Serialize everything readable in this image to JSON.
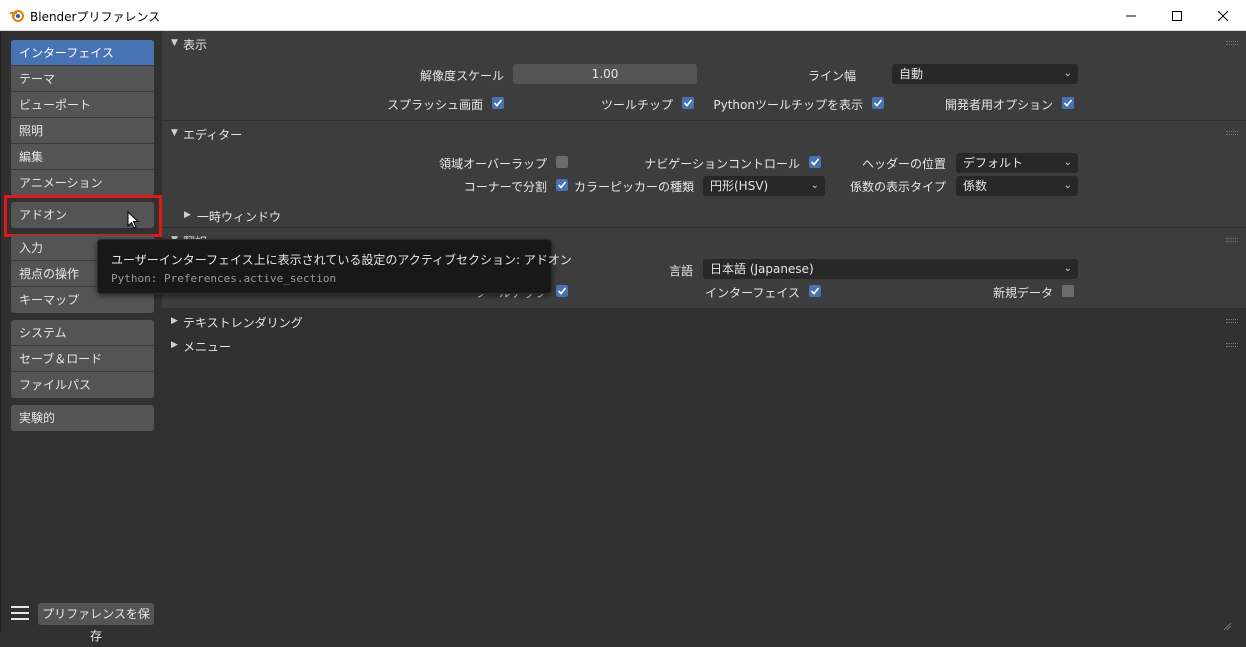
{
  "window": {
    "title": "Blenderプリファレンス",
    "minimize_icon": "minimize-icon",
    "maximize_icon": "maximize-icon",
    "close_icon": "close-icon"
  },
  "sidebar": {
    "group1": [
      "インターフェイス",
      "テーマ",
      "ビューポート",
      "照明",
      "編集",
      "アニメーション"
    ],
    "group2": [
      "アドオン"
    ],
    "group3": [
      "入力",
      "視点の操作",
      "キーマップ"
    ],
    "group4": [
      "システム",
      "セーブ＆ロード",
      "ファイルパス"
    ],
    "group5": [
      "実験的"
    ],
    "active": "インターフェイス",
    "save_button": "プリファレンスを保存"
  },
  "display_panel": {
    "title": "表示",
    "resolution_scale_label": "解像度スケール",
    "resolution_scale_value": "1.00",
    "line_width_label": "ライン幅",
    "line_width_value": "自動",
    "splash_label": "スプラッシュ画面",
    "splash_checked": true,
    "tooltips_label": "ツールチップ",
    "tooltips_checked": true,
    "python_tooltips_label": "Pythonツールチップを表示",
    "python_tooltips_checked": true,
    "dev_extras_label": "開発者用オプション",
    "dev_extras_checked": true
  },
  "editors_panel": {
    "title": "エディター",
    "region_overlap_label": "領域オーバーラップ",
    "region_overlap_checked": false,
    "nav_controls_label": "ナビゲーションコントロール",
    "nav_controls_checked": true,
    "header_position_label": "ヘッダーの位置",
    "header_position_value": "デフォルト",
    "corner_split_label": "コーナーで分割",
    "corner_split_checked": true,
    "color_picker_label": "カラーピッカーの種類",
    "color_picker_value": "円形(HSV)",
    "factor_display_label": "係数の表示タイプ",
    "factor_display_value": "係数",
    "temp_windows_label": "一時ウィンドウ"
  },
  "translation_panel": {
    "title": "翻訳",
    "language_label": "言語",
    "language_value": "日本語 (Japanese)",
    "tooltips_label": "ツールチップ",
    "tooltips_checked": true,
    "interface_label": "インターフェイス",
    "interface_checked": true,
    "new_data_label": "新規データ",
    "new_data_checked": false
  },
  "text_rendering_panel": {
    "title": "テキストレンダリング"
  },
  "menus_panel": {
    "title": "メニュー"
  },
  "tooltip": {
    "line1": "ユーザーインターフェイス上に表示されている設定のアクティブセクション:  アドオン",
    "line2": "Python: Preferences.active_section"
  }
}
